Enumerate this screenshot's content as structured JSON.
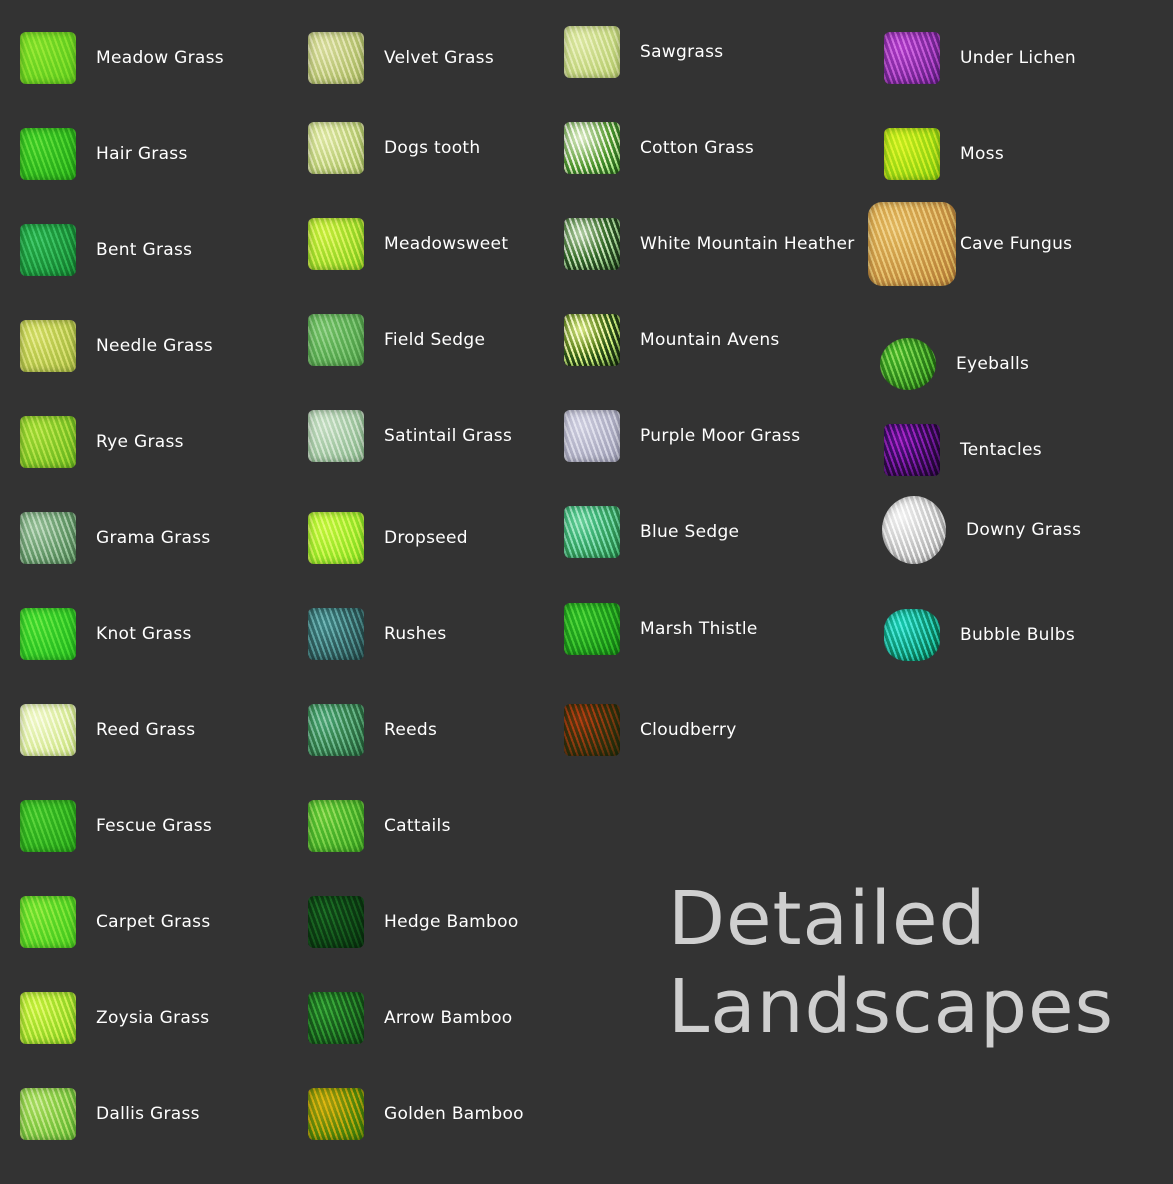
{
  "catalog_title": [
    "Detailed",
    "Landscapes"
  ],
  "columns": [
    {
      "items": [
        {
          "label": "Meadow Grass",
          "colors": [
            "#6aa83a",
            "#8fcc55"
          ],
          "icon": "meadow-grass-icon"
        },
        {
          "label": "Hair Grass",
          "colors": [
            "#3f8f32",
            "#74c25a"
          ],
          "icon": "hair-grass-icon"
        },
        {
          "label": "Bent Grass",
          "colors": [
            "#2f7a4a",
            "#5fae78"
          ],
          "icon": "bent-grass-icon"
        },
        {
          "label": "Needle Grass",
          "colors": [
            "#8d9a55",
            "#c9cf8a"
          ],
          "icon": "needle-grass-icon"
        },
        {
          "label": "Rye Grass",
          "colors": [
            "#6f9a3a",
            "#a8cc6a"
          ],
          "icon": "rye-grass-icon"
        },
        {
          "label": "Grama Grass",
          "colors": [
            "#5f7a62",
            "#a9bfa9"
          ],
          "icon": "grama-grass-icon"
        },
        {
          "label": "Knot Grass",
          "colors": [
            "#3f9a3a",
            "#78cc60"
          ],
          "icon": "knot-grass-icon"
        },
        {
          "label": "Reed Grass",
          "colors": [
            "#a9bf7a",
            "#e6efc8"
          ],
          "icon": "reed-grass-icon"
        },
        {
          "label": "Fescue Grass",
          "colors": [
            "#3f8a32",
            "#6fb85a"
          ],
          "icon": "fescue-grass-icon"
        },
        {
          "label": "Carpet Grass",
          "colors": [
            "#5aa83a",
            "#8fd060"
          ],
          "icon": "carpet-grass-icon"
        },
        {
          "label": "Zoysia Grass",
          "colors": [
            "#7aa83a",
            "#c4e67a"
          ],
          "icon": "zoysia-grass-icon"
        },
        {
          "label": "Dallis Grass",
          "colors": [
            "#6a9a4a",
            "#b2d090"
          ],
          "icon": "dallis-grass-icon"
        }
      ]
    },
    {
      "items": [
        {
          "label": "Velvet Grass",
          "colors": [
            "#8f9a6a",
            "#cfd0a8"
          ],
          "icon": "velvet-grass-icon"
        },
        {
          "label": "Dogs tooth",
          "colors": [
            "#8f9f6a",
            "#d6dcae"
          ],
          "icon": "dogs-tooth-icon"
        },
        {
          "label": "Meadowsweet",
          "colors": [
            "#7aa83a",
            "#c6e27a"
          ],
          "icon": "meadowsweet-icon"
        },
        {
          "label": "Field Sedge",
          "colors": [
            "#5f8a5a",
            "#8fb88a"
          ],
          "icon": "field-sedge-icon"
        },
        {
          "label": "Satintail Grass",
          "colors": [
            "#7f9a80",
            "#c2d2c0"
          ],
          "icon": "satintail-grass-icon"
        },
        {
          "label": "Dropseed",
          "colors": [
            "#7ab83a",
            "#c2ea7a"
          ],
          "icon": "dropseed-icon"
        },
        {
          "label": "Rushes",
          "colors": [
            "#3f5a5a",
            "#7aa0a0"
          ],
          "icon": "rushes-icon"
        },
        {
          "label": "Reeds",
          "colors": [
            "#3f6a50",
            "#8ab09a"
          ],
          "icon": "reeds-icon"
        },
        {
          "label": "Cattails",
          "colors": [
            "#4f8a3a",
            "#8fc070"
          ],
          "icon": "cattails-icon"
        },
        {
          "label": "Hedge Bamboo",
          "colors": [
            "#1f4a28",
            "#3f7a48"
          ],
          "icon": "hedge-bamboo-icon"
        },
        {
          "label": "Arrow Bamboo",
          "colors": [
            "#2a5a30",
            "#5a9a5a"
          ],
          "icon": "arrow-bamboo-icon"
        },
        {
          "label": "Golden Bamboo",
          "colors": [
            "#4f7a20",
            "#c2a030"
          ],
          "icon": "golden-bamboo-icon"
        }
      ]
    },
    {
      "items": [
        {
          "label": "Sawgrass",
          "colors": [
            "#9aaa72",
            "#cfd8a8"
          ],
          "icon": "sawgrass-icon"
        },
        {
          "label": "Cotton Grass",
          "colors": [
            "#3f6a30",
            "#e8eedc"
          ],
          "icon": "cotton-grass-icon"
        },
        {
          "label": "White Mountain Heather",
          "colors": [
            "#2f4a2a",
            "#cfdcc8"
          ],
          "icon": "white-mountain-heather-icon"
        },
        {
          "label": "Mountain Avens",
          "colors": [
            "#2a4020",
            "#e8f0b8"
          ],
          "icon": "mountain-avens-icon"
        },
        {
          "label": "Purple Moor Grass",
          "colors": [
            "#8a8a98",
            "#c8c8d6"
          ],
          "icon": "purple-moor-grass-icon"
        },
        {
          "label": "Blue Sedge",
          "colors": [
            "#3f7a5a",
            "#9ad0b0"
          ],
          "icon": "blue-sedge-icon"
        },
        {
          "label": "Marsh Thistle",
          "colors": [
            "#2f7a30",
            "#6aba5a"
          ],
          "icon": "marsh-thistle-icon"
        },
        {
          "label": "Cloudberry",
          "colors": [
            "#3a4a25",
            "#a05a30"
          ],
          "icon": "cloudberry-icon"
        }
      ]
    },
    {
      "items": [
        {
          "label": "Under Lichen",
          "colors": [
            "#6a3a7a",
            "#b87ac8"
          ],
          "icon": "under-lichen-icon"
        },
        {
          "label": "Moss",
          "colors": [
            "#7aa82a",
            "#c4e050"
          ],
          "icon": "moss-icon"
        },
        {
          "label": "Cave Fungus",
          "colors": [
            "#9a7a50",
            "#d8b88a"
          ],
          "icon": "cave-fungus-icon"
        },
        {
          "label": "Eyeballs",
          "colors": [
            "#3a6a2a",
            "#8ac070"
          ],
          "icon": "eyeballs-icon"
        },
        {
          "label": "Tentacles",
          "colors": [
            "#3a1a4a",
            "#9a4ab0"
          ],
          "icon": "tentacles-icon"
        },
        {
          "label": "Downy Grass",
          "colors": [
            "#8a8a8a",
            "#f0f0f0"
          ],
          "icon": "downy-grass-icon"
        },
        {
          "label": "Bubble Bulbs",
          "colors": [
            "#1a6a5a",
            "#6ad0c0"
          ],
          "icon": "bubble-bulbs-icon"
        }
      ]
    }
  ]
}
